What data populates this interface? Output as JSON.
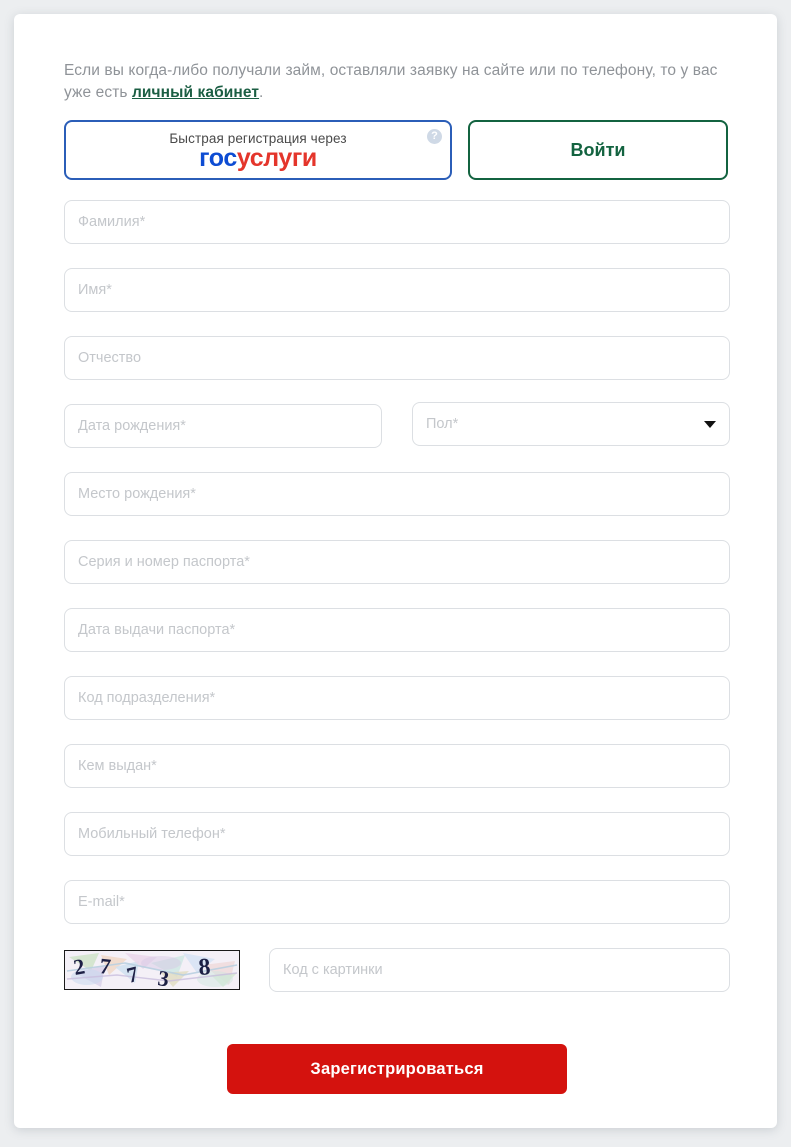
{
  "intro": {
    "text_before": "Если вы когда-либо получали займ, оставляли заявку на сайте или по телефону, то у вас уже есть ",
    "link_text": "личный кабинет",
    "text_after": "."
  },
  "gosuslugi_button": {
    "caption": "Быстрая регистрация через",
    "logo_part_blue": "гос",
    "logo_part_red": "услуги",
    "help_icon": "question-mark-icon",
    "help_glyph": "?",
    "border_color": "#2b5eb8",
    "blue": "#0d4cd3",
    "red": "#e4352b"
  },
  "login_button": {
    "label": "Войти",
    "color": "#136340"
  },
  "form": {
    "fields": [
      {
        "name": "surname",
        "placeholder": "Фамилия*"
      },
      {
        "name": "firstname",
        "placeholder": "Имя*"
      },
      {
        "name": "patronymic",
        "placeholder": "Отчество"
      },
      {
        "name": "birth-date",
        "placeholder": "Дата рождения*"
      },
      {
        "name": "gender",
        "placeholder": "Пол*"
      },
      {
        "name": "birth-place",
        "placeholder": "Место рождения*"
      },
      {
        "name": "passport-serial",
        "placeholder": "Серия и номер паспорта*"
      },
      {
        "name": "passport-date",
        "placeholder": "Дата выдачи паспорта*"
      },
      {
        "name": "division-code",
        "placeholder": "Код подразделения*"
      },
      {
        "name": "issued-by",
        "placeholder": "Кем выдан*"
      },
      {
        "name": "mobile-phone",
        "placeholder": "Мобильный телефон*"
      },
      {
        "name": "email",
        "placeholder": "E-mail*"
      },
      {
        "name": "captcha",
        "placeholder": "Код с картинки"
      }
    ],
    "gender_caret": "chevron-down-icon"
  },
  "captcha": {
    "alt": "captcha-image",
    "digits": "27738"
  },
  "submit": {
    "label": "Зарегистрироваться",
    "color": "#d4120e"
  }
}
